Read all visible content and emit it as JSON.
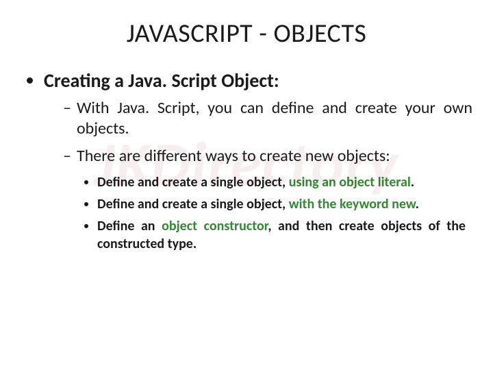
{
  "title": "JAVASCRIPT - OBJECTS",
  "watermark": "JKDirectory",
  "topic": {
    "heading": "Creating a Java. Script Object:",
    "points": [
      "With Java. Script, you can define and create your own objects.",
      "There are different ways to create new objects:"
    ],
    "ways": [
      {
        "pre": "Define and create a single object, ",
        "hl": "using an object literal",
        "post": "."
      },
      {
        "pre": "Define and create a single object, ",
        "hl": "with the keyword new",
        "post": "."
      },
      {
        "pre": "Define an ",
        "hl": "object constructor",
        "post": ", and then create objects of the constructed type."
      }
    ]
  },
  "colors": {
    "highlight": "#2e8b2e",
    "text": "#1a1a1a"
  }
}
